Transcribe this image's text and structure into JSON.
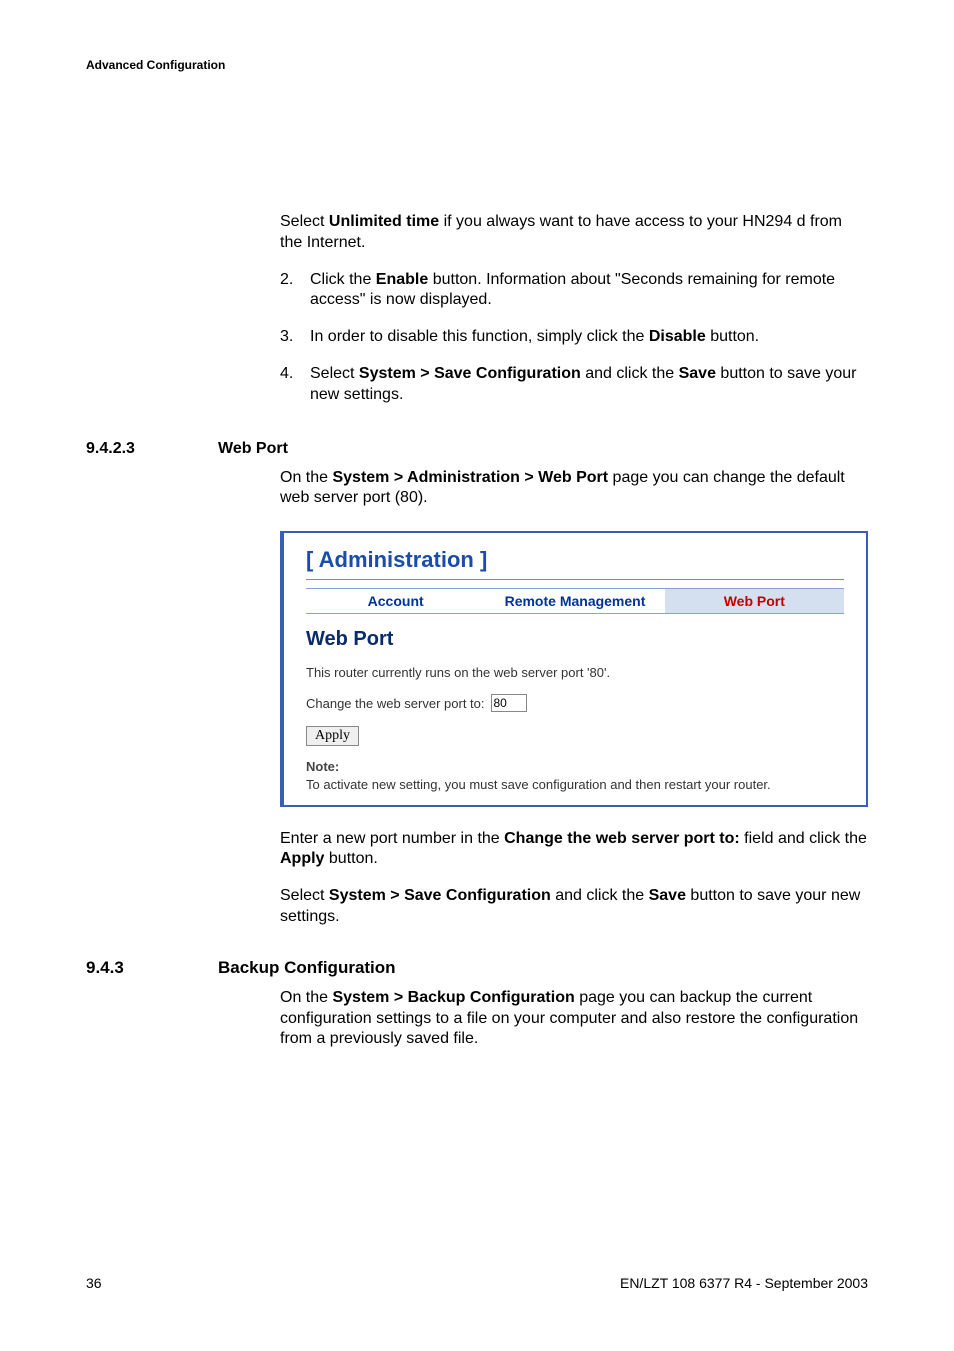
{
  "header": "Advanced Configuration",
  "intro": {
    "select": "Select ",
    "unlimited": "Unlimited time",
    "rest": " if you always want to have access to your HN294 d from the Internet."
  },
  "steps": [
    {
      "n": "2.",
      "parts": [
        "Click the ",
        "Enable",
        " button. Information about \"Seconds remaining for remote access\" is now displayed."
      ]
    },
    {
      "n": "3.",
      "parts": [
        "In order to disable this function, simply click the ",
        "Disable",
        " button."
      ]
    },
    {
      "n": "4.",
      "parts": [
        "Select ",
        "System > Save Configuration",
        " and click the ",
        "Save",
        " button to save your new settings."
      ]
    }
  ],
  "sec9423": {
    "num": "9.4.2.3",
    "title": "Web Port"
  },
  "sec9423_body": {
    "pre": "On the ",
    "bold": "System > Administration > Web Port",
    "post": " page you can change the default web server port (80)."
  },
  "screenshot": {
    "heading": "[ Administration ]",
    "tabs": {
      "account": "Account",
      "remote": "Remote Management",
      "webport": "Web Port"
    },
    "subhead": "Web Port",
    "line1": "This router currently runs on the web server port '80'.",
    "changeLabel": "Change the web server port to:",
    "portValue": "80",
    "apply": "Apply",
    "noteLabel": "Note:",
    "noteText": "To activate new setting, you must save configuration and then restart your router."
  },
  "after1": {
    "pre": "Enter a new port number in the ",
    "b1": "Change the web server port to:",
    "mid": " field and click the ",
    "b2": "Apply",
    "post": " button."
  },
  "after2": {
    "pre": "Select ",
    "b1": "System > Save Configuration",
    "mid": " and click the ",
    "b2": "Save",
    "post": " button to save your new settings."
  },
  "sec943": {
    "num": "9.4.3",
    "title": "Backup Configuration"
  },
  "sec943_body": {
    "pre": "On the ",
    "bold": "System > Backup Configuration",
    "post": " page you can backup the current configuration settings to a file on your computer and also restore the configuration from a previously saved file."
  },
  "footer": {
    "page": "36",
    "doc": "EN/LZT 108 6377 R4 - September 2003"
  }
}
